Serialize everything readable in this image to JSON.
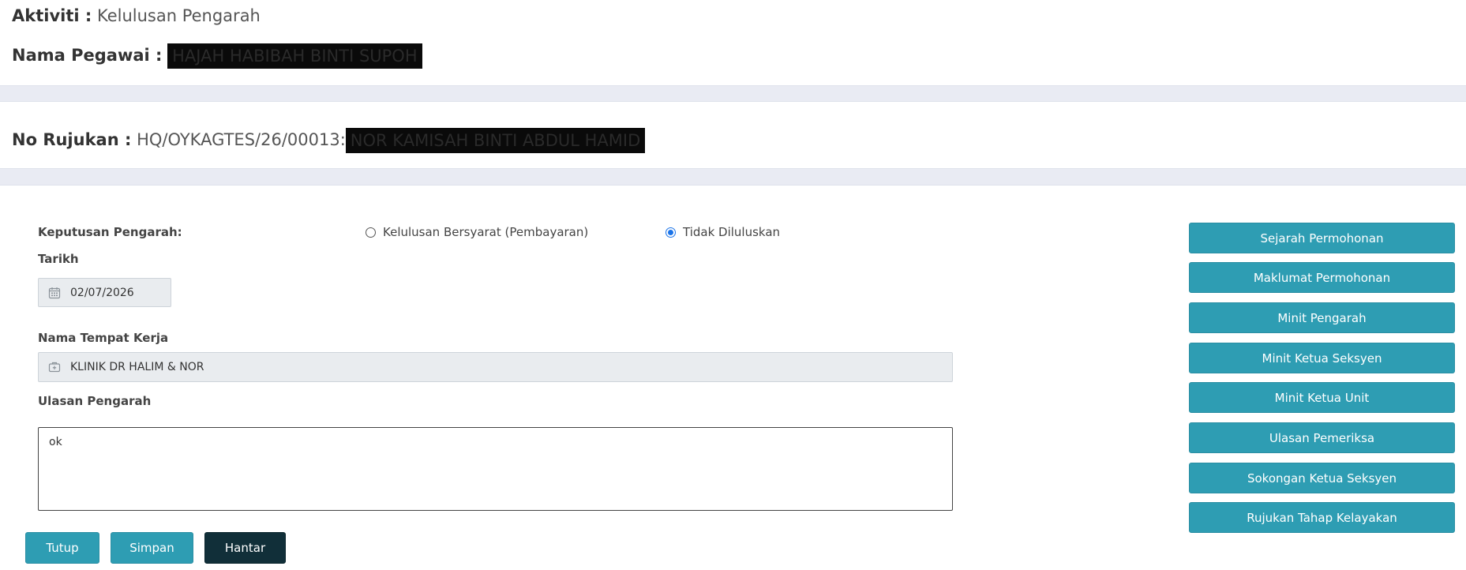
{
  "header": {
    "activity_label": "Aktiviti :",
    "activity_value": "Kelulusan Pengarah",
    "officer_label": "Nama Pegawai :",
    "officer_value": "HAJAH HABIBAH BINTI SUPOH"
  },
  "reference": {
    "label": "No Rujukan :",
    "number": "HQ/OYKAGTES/26/00013:",
    "name": "NOR KAMISAH BINTI ABDUL HAMID"
  },
  "form": {
    "decision_label": "Keputusan Pengarah:",
    "radio_options": [
      {
        "label": "Kelulusan Bersyarat (Pembayaran)",
        "checked": false
      },
      {
        "label": "Tidak Diluluskan",
        "checked": true
      }
    ],
    "date_label": "Tarikh",
    "date_value": "02/07/2026",
    "workplace_label": "Nama Tempat Kerja",
    "workplace_value": "KLINIK DR HALIM & NOR",
    "comment_label": "Ulasan Pengarah",
    "comment_value": "ok"
  },
  "actions": {
    "close_label": "Tutup",
    "save_label": "Simpan",
    "submit_label": "Hantar"
  },
  "side_menu": {
    "items": [
      {
        "label": "Sejarah Permohonan"
      },
      {
        "label": "Maklumat Permohonan"
      },
      {
        "label": "Minit Pengarah"
      },
      {
        "label": "Minit Ketua Seksyen"
      },
      {
        "label": "Minit Ketua Unit"
      },
      {
        "label": "Ulasan Pemeriksa"
      },
      {
        "label": "Sokongan Ketua Seksyen"
      },
      {
        "label": "Rujukan Tahap Kelayakan"
      }
    ]
  },
  "icons": {
    "date_icon": "calendar-icon",
    "workplace_icon": "medical-kit-icon"
  },
  "colors": {
    "teal_button": "#2e9db3",
    "dark_button": "#112f39",
    "band": "#e9ebf3",
    "radio_selected": "#1a73e8"
  }
}
